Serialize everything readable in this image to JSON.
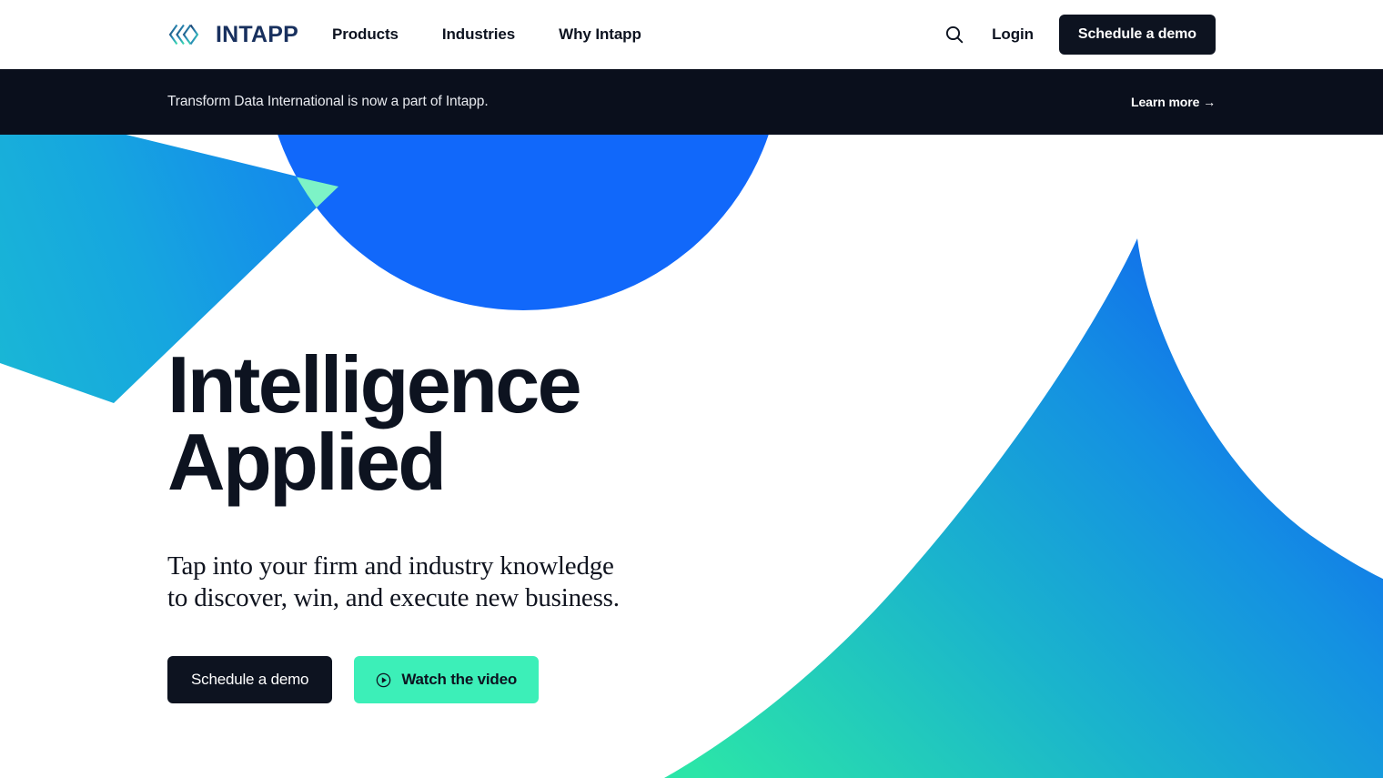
{
  "brand": {
    "name": "INTAPP",
    "logo_icon": "intapp-chevron-logo",
    "logo_gradient_from": "#1b3a6b",
    "logo_gradient_to": "#3ce0b0",
    "wordmark_color": "#18305e"
  },
  "header": {
    "nav": [
      {
        "label": "Products"
      },
      {
        "label": "Industries"
      },
      {
        "label": "Why Intapp"
      }
    ],
    "search_icon": "search-icon",
    "login_label": "Login",
    "demo_label": "Schedule a demo",
    "demo_bg": "#0d1320"
  },
  "banner": {
    "text": "Transform Data International is now a part of Intapp.",
    "link_label": "Learn more →",
    "bg": "#0a0f1c"
  },
  "hero": {
    "title_line1": "Intelligence",
    "title_line2": "Applied",
    "subtitle_line1": "Tap into your firm and industry knowledge",
    "subtitle_line2": "to discover, win, and execute new business.",
    "primary_cta": "Schedule a demo",
    "secondary_cta": "Watch the video",
    "play_icon": "play-circle-icon",
    "primary_cta_bg": "#0d1320",
    "secondary_cta_bg": "#3CEFB8",
    "title_color": "#0d1320"
  },
  "decor": {
    "left_triangle_from": "#1cc0d0",
    "left_triangle_to": "#1380f0",
    "circle_color": "#1168fa",
    "overlap_color": "#7df3c6",
    "wing_from": "#2BE5A8",
    "wing_to": "#1064EE"
  }
}
